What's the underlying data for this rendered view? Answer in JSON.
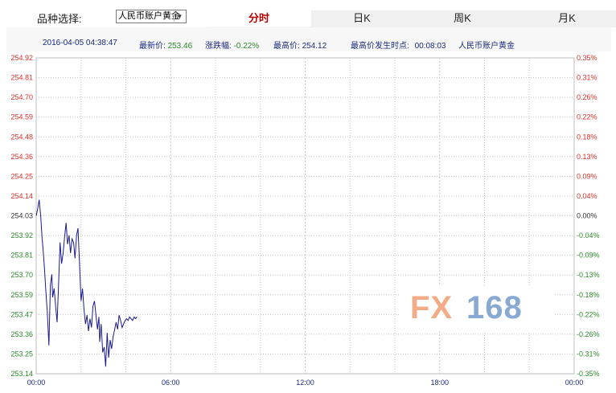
{
  "selector": {
    "label": "品种选择:",
    "value": "人民币账户黄金"
  },
  "tabs": [
    {
      "label": "分时",
      "active": true
    },
    {
      "label": "日K",
      "active": false
    },
    {
      "label": "周K",
      "active": false
    },
    {
      "label": "月K",
      "active": false
    }
  ],
  "info": {
    "datetime": "2016-04-05 04:38:47",
    "latest_label": "最新价:",
    "latest_value": "253.46",
    "change_label": "涨跌幅:",
    "change_value": "-0.22%",
    "high_label": "最高价:",
    "high_value": "254.12",
    "high_time_label": "最高价发生时点:",
    "high_time_value": "00:08:03",
    "product": "人民币账户黄金"
  },
  "logo": {
    "left": "FX",
    "right": "168"
  },
  "colors": {
    "up": "#e0302a",
    "down": "#2a8a2a",
    "neutral": "#333333",
    "line": "#1a1a8c",
    "grid": "#c8c8c8",
    "axis_text": "#1a2a80"
  },
  "chart_data": {
    "type": "line",
    "title": "",
    "xlabel": "",
    "ylabel": "",
    "ylim": [
      253.14,
      254.92
    ],
    "base_price": 254.03,
    "y_ticks_left": [
      "254.92",
      "254.81",
      "254.70",
      "254.59",
      "254.48",
      "254.36",
      "254.25",
      "254.14",
      "254.03",
      "253.92",
      "253.81",
      "253.70",
      "253.59",
      "253.47",
      "253.36",
      "253.25",
      "253.14"
    ],
    "y_ticks_right": [
      "0.35%",
      "0.31%",
      "0.26%",
      "0.22%",
      "0.18%",
      "0.13%",
      "0.09%",
      "0.04%",
      "0.00%",
      "-0.04%",
      "-0.09%",
      "-0.13%",
      "-0.18%",
      "-0.22%",
      "-0.26%",
      "-0.31%",
      "-0.35%"
    ],
    "x_ticks": [
      "00:00",
      "06:00",
      "12:00",
      "18:00",
      "00:00"
    ],
    "x_range_minutes": [
      0,
      1440
    ],
    "grid": true,
    "series": [
      {
        "x_minutes": [
          0,
          4,
          8,
          12,
          16,
          18,
          22,
          26,
          30,
          34,
          38,
          42,
          44,
          48,
          52,
          56,
          60,
          64,
          68,
          72,
          76,
          80,
          84,
          88,
          92,
          96,
          100,
          104,
          108,
          112,
          116,
          120,
          124,
          128,
          132,
          136,
          140,
          144,
          148,
          152,
          156,
          160,
          164,
          168,
          170,
          174,
          178,
          182,
          186,
          190,
          194,
          198,
          202,
          206,
          210,
          214,
          218,
          222,
          226,
          230,
          234,
          238,
          242,
          246,
          250,
          254,
          258,
          262,
          266,
          270
        ],
        "values": [
          254.03,
          254.07,
          254.12,
          254.03,
          253.9,
          253.85,
          253.74,
          253.6,
          253.48,
          253.3,
          253.64,
          253.7,
          253.57,
          253.62,
          253.52,
          253.43,
          253.65,
          253.88,
          253.76,
          253.82,
          253.91,
          253.99,
          253.87,
          253.92,
          253.82,
          253.9,
          253.88,
          253.79,
          253.92,
          253.96,
          253.76,
          253.55,
          253.62,
          253.5,
          253.42,
          253.47,
          253.38,
          253.45,
          253.4,
          253.52,
          253.55,
          253.47,
          253.39,
          253.46,
          253.32,
          253.42,
          253.26,
          253.29,
          253.18,
          253.37,
          253.23,
          253.33,
          253.28,
          253.35,
          253.39,
          253.43,
          253.39,
          253.47,
          253.44,
          253.4,
          253.42,
          253.44,
          253.45,
          253.44,
          253.46,
          253.45,
          253.44,
          253.46,
          253.45,
          253.46
        ]
      }
    ]
  }
}
